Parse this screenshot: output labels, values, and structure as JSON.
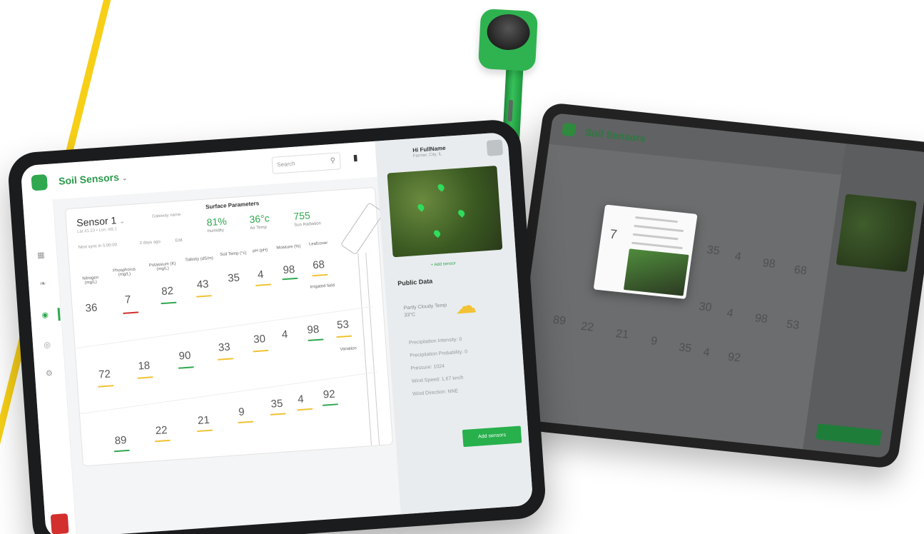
{
  "app": {
    "title": "Soil Sensors",
    "title_caret": "⌄"
  },
  "header": {
    "search_placeholder": "Search",
    "user_name": "Hi FullName",
    "user_sub": "Farmer, City, IL"
  },
  "sensor": {
    "name": "Sensor 1",
    "name_caret": "⌄",
    "sub": "Lat 41.23 • Lon -88.1",
    "meta1": "Next sync in 5:00:00",
    "meta2": "3 days ago",
    "meta3": "Edit",
    "gateway": "Gateway name"
  },
  "surface": {
    "title": "Surface Parameters",
    "items": [
      {
        "value": "81%",
        "label": "Humidity"
      },
      {
        "value": "36°c",
        "label": "Air Temp"
      },
      {
        "value": "755",
        "label": "Sun Radiation"
      }
    ]
  },
  "columns": [
    "Nitrogen (mg/L)",
    "Phosphorus (mg/L)",
    "Potassium (K) (mg/L)",
    "Salinity (dS/m)",
    "Soil Temp (°c)",
    "pH (pH)",
    "Moisture (%)",
    "Leafcover"
  ],
  "rows": [
    [
      "36",
      "7",
      "82",
      "43",
      "35",
      "4",
      "98",
      "68"
    ],
    [
      "72",
      "18",
      "90",
      "33",
      "30",
      "4",
      "98",
      "53"
    ],
    [
      "89",
      "22",
      "21",
      "9",
      "35",
      "4",
      "92",
      ""
    ]
  ],
  "row_tags": [
    "Irrigated field",
    "Variation"
  ],
  "public": {
    "title": "Public Data",
    "map_link": "+ Add sensor",
    "weather": "Partly Cloudy Temp 33°C",
    "items": [
      "Precipitation Intensity: 0",
      "Precipitation Probability: 0",
      "Pressure: 1024",
      "Wind Speed: 1.67 km/h",
      "Wind Direction: NNE"
    ]
  },
  "add_button": "Add sensors",
  "sidebar_icons": [
    "grid-icon",
    "leaf-icon",
    "sensor-icon",
    "globe-icon",
    "gear-icon"
  ],
  "accent_color": "#2fa84f",
  "back_tablet": {
    "title": "Soil Sensors",
    "popup_number": "7",
    "numbers": [
      "35",
      "4",
      "98",
      "68",
      "30",
      "4",
      "98",
      "53",
      "89",
      "22",
      "21",
      "9",
      "35",
      "4",
      "92"
    ]
  }
}
